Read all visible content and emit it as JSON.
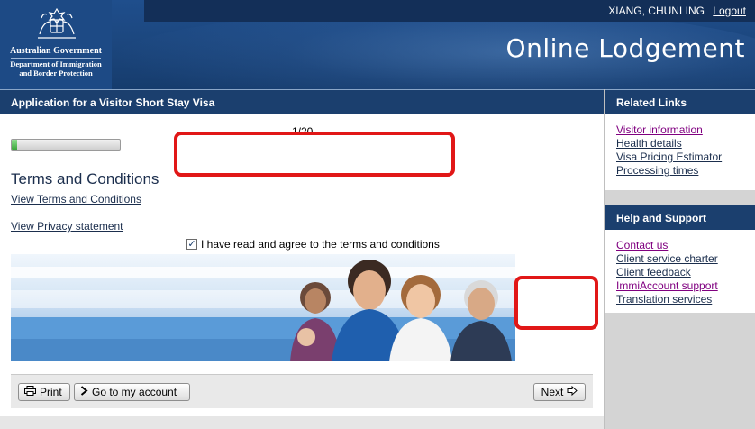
{
  "header": {
    "gov_name": "Australian Government",
    "dept_name_line1": "Department of Immigration",
    "dept_name_line2": "and Border Protection",
    "user_name": "XIANG, CHUNLING",
    "logout_label": "Logout",
    "site_title": "Online Lodgement"
  },
  "main": {
    "app_title": "Application for a Visitor Short Stay Visa",
    "progress": {
      "label": "1/20",
      "fraction": 0.05
    },
    "section_title": "Terms and Conditions",
    "link_terms": "View Terms and Conditions",
    "link_privacy": "View Privacy statement",
    "agree_label": "I have read and agree to the terms and conditions",
    "agree_checked": true
  },
  "buttons": {
    "print": "Print",
    "account": "Go to my account",
    "next": "Next"
  },
  "sidebar": {
    "related": {
      "title": "Related Links",
      "links": [
        {
          "label": "Visitor information",
          "visited": true
        },
        {
          "label": "Health details",
          "visited": false
        },
        {
          "label": "Visa Pricing Estimator",
          "visited": false
        },
        {
          "label": "Processing times",
          "visited": false
        }
      ]
    },
    "help": {
      "title": "Help and Support",
      "links": [
        {
          "label": "Contact us",
          "visited": true
        },
        {
          "label": "Client service charter",
          "visited": false
        },
        {
          "label": "Client feedback",
          "visited": false
        },
        {
          "label": "ImmiAccount support",
          "visited": true
        },
        {
          "label": "Translation services",
          "visited": false
        }
      ]
    }
  },
  "colors": {
    "brand_dark": "#1b3f6e",
    "highlight_red": "#e11717",
    "progress_green": "#3aa53a"
  }
}
